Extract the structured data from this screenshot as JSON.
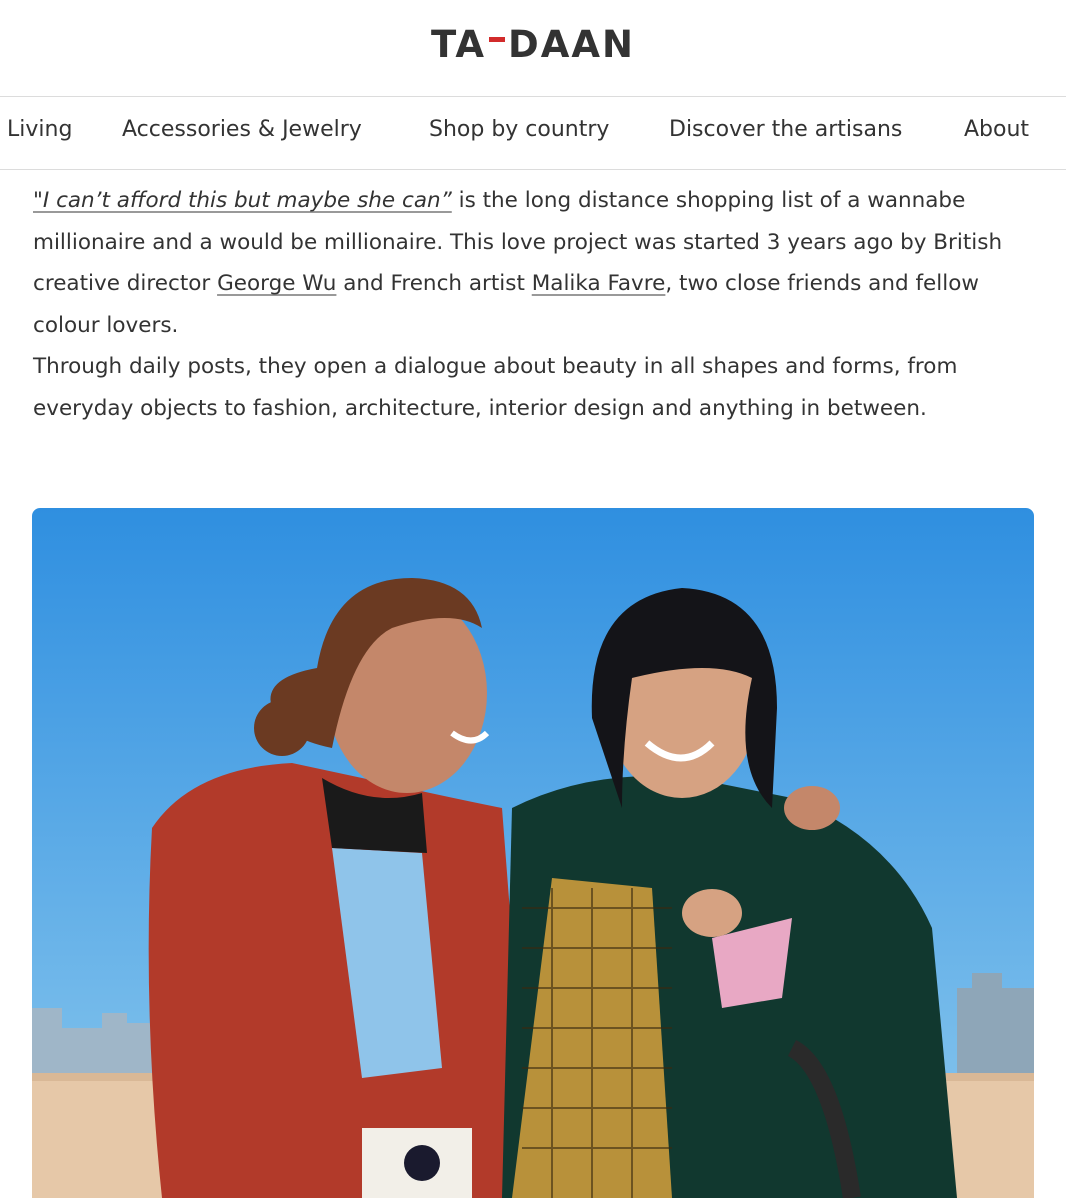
{
  "header": {
    "logo_left": "TA",
    "logo_right": "DAAN"
  },
  "nav": {
    "items": [
      {
        "label": "Living"
      },
      {
        "label": "Accessories & Jewelry"
      },
      {
        "label": "Shop by country"
      },
      {
        "label": "Discover the artisans"
      },
      {
        "label": "About"
      }
    ]
  },
  "article": {
    "quote_link": "\"I can’t afford this but maybe she can”",
    "line1_rest": " is the long distance shopping list of a wannabe millionaire and a would be millionaire. This love project was started 3 years ago by British creative director ",
    "person1": "George Wu",
    "mid_text": " and French artist ",
    "person2": "Malika Favre",
    "line3_rest": ", two close friends and fellow colour lovers.",
    "paragraph2": "Through daily posts, they open a dialogue about beauty in all shapes and forms, from everyday objects to fashion, architecture, interior design and anything in between."
  },
  "photo": {
    "sky_top": "#2f8fe0",
    "sky_bottom": "#7fc3ef"
  }
}
